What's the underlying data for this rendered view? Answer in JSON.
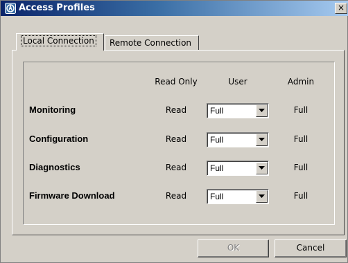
{
  "window": {
    "title": "Access Profiles",
    "close_glyph": "×",
    "app_icon": "app-icon"
  },
  "tabs": [
    {
      "label": "Local Connection",
      "active": true
    },
    {
      "label": "Remote Connection",
      "active": false
    }
  ],
  "table": {
    "columns": [
      "Read Only",
      "User",
      "Admin"
    ],
    "rows": [
      {
        "label": "Monitoring",
        "read_only": "Read",
        "user": "Full",
        "admin": "Full"
      },
      {
        "label": "Configuration",
        "read_only": "Read",
        "user": "Full",
        "admin": "Full"
      },
      {
        "label": "Diagnostics",
        "read_only": "Read",
        "user": "Full",
        "admin": "Full"
      },
      {
        "label": "Firmware Download",
        "read_only": "Read",
        "user": "Full",
        "admin": "Full"
      }
    ]
  },
  "buttons": {
    "ok": {
      "label": "OK",
      "enabled": false
    },
    "cancel": {
      "label": "Cancel",
      "enabled": true
    }
  },
  "colors": {
    "titlebar_start": "#0a246a",
    "titlebar_end": "#a6caf0",
    "dialog_face": "#d4d0c8"
  }
}
